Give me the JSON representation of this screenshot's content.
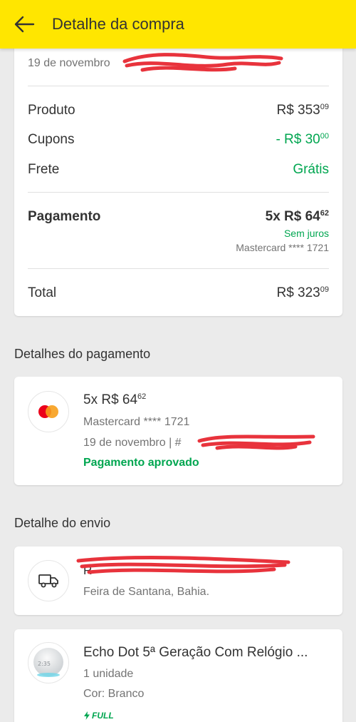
{
  "header": {
    "title": "Detalhe da compra"
  },
  "summary": {
    "date": "19 de novembro",
    "product": {
      "label": "Produto",
      "int": "R$ 353",
      "cents": "09"
    },
    "coupons": {
      "label": "Cupons",
      "int": "- R$ 30",
      "cents": "00"
    },
    "shipping": {
      "label": "Frete",
      "value": "Grátis"
    },
    "payment": {
      "label": "Pagamento",
      "int": "5x R$ 64",
      "cents": "62",
      "interest": "Sem juros",
      "card": "Mastercard **** 1721"
    },
    "total": {
      "label": "Total",
      "int": "R$ 323",
      "cents": "09"
    }
  },
  "payment_details": {
    "title": "Detalhes do pagamento",
    "int": "5x R$ 64",
    "cents": "62",
    "card": "Mastercard **** 1721",
    "date": "19 de novembro  |  #",
    "status": "Pagamento aprovado"
  },
  "shipping_details": {
    "title": "Detalhe do envio",
    "address_prefix": "R",
    "city": "Feira de Santana, Bahia."
  },
  "product": {
    "name": "Echo Dot 5ª Geração Com Relógio ...",
    "quantity": "1 unidade",
    "color": "Cor: Branco",
    "badge": "FULL",
    "device_time": "2:35"
  },
  "colors": {
    "accent_yellow": "#ffe600",
    "green": "#00a650",
    "redaction": "#e8333c"
  },
  "icons": {
    "back": "arrow-left-icon",
    "card": "mastercard-icon",
    "shipping": "truck-icon",
    "full": "lightning-icon"
  }
}
